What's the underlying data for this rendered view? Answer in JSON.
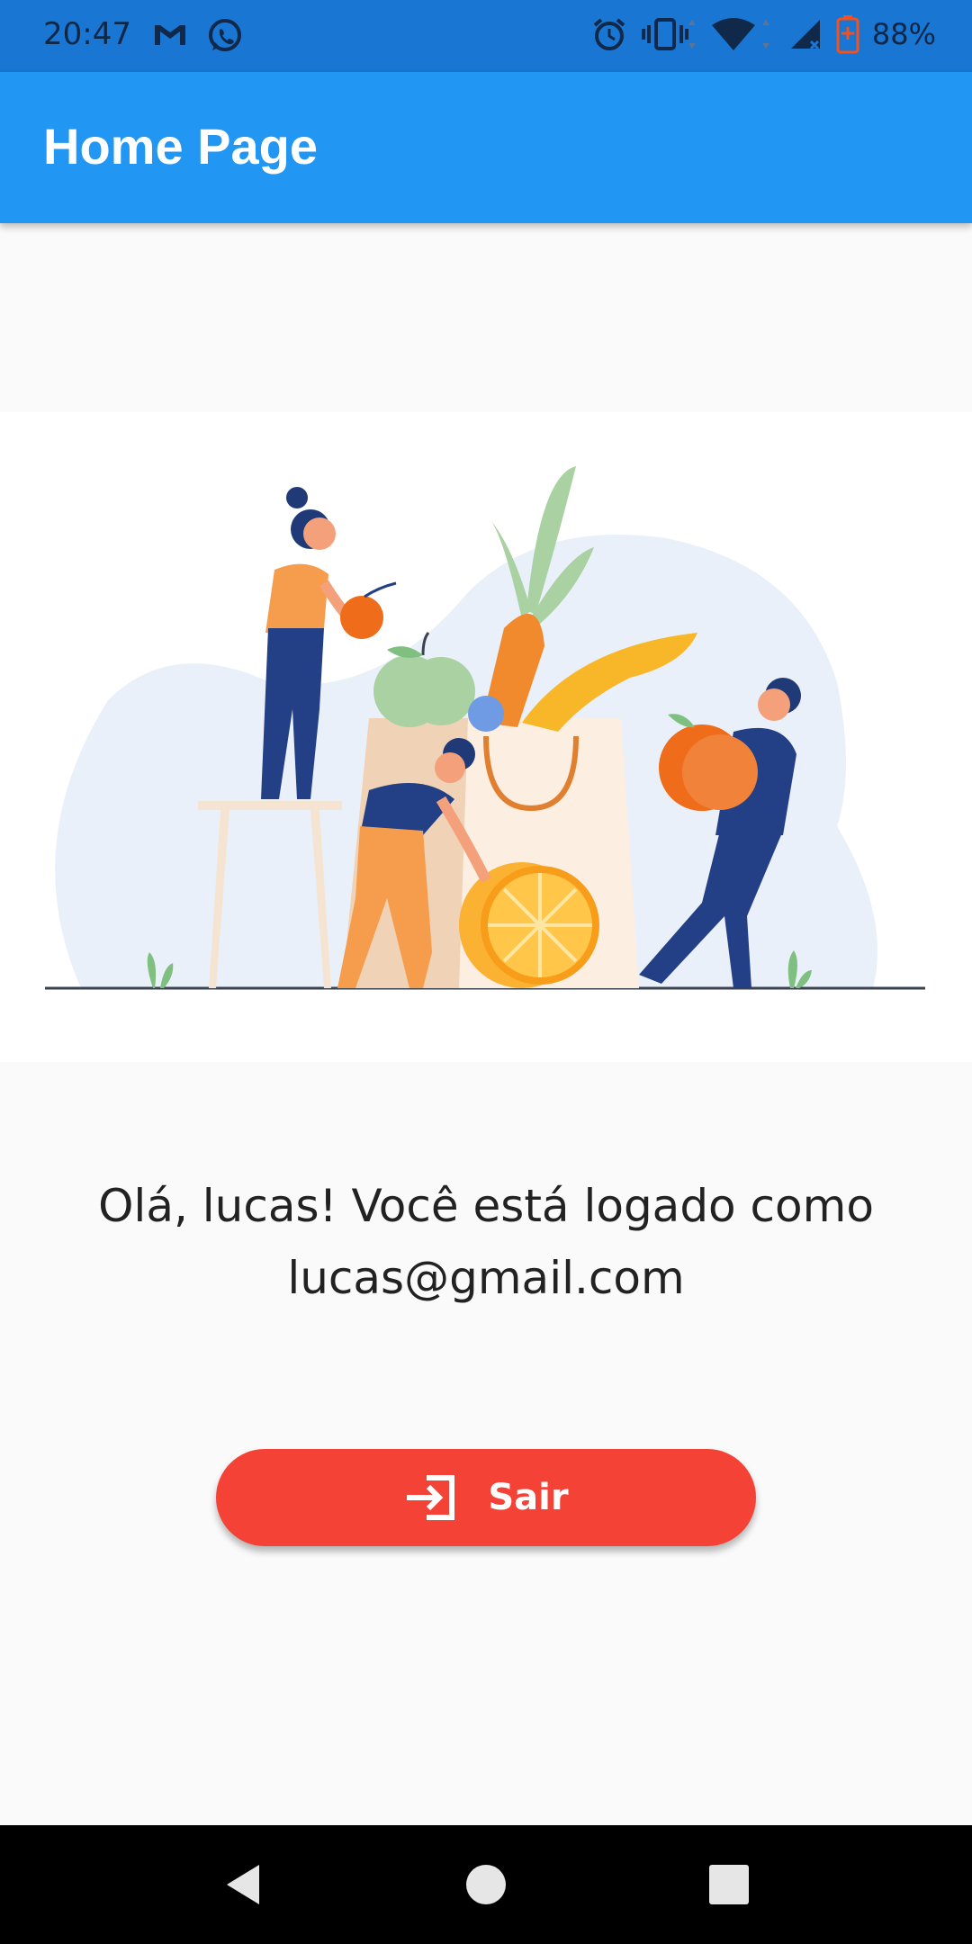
{
  "status_bar": {
    "time": "20:47",
    "battery": "88%",
    "icons": [
      "gmail-icon",
      "whatsapp-icon",
      "alarm-icon",
      "vibrate-icon",
      "wifi-icon",
      "signal-icon",
      "battery-icon"
    ]
  },
  "app_bar": {
    "title": "Home Page",
    "color": "#2196f3"
  },
  "main": {
    "greeting_line1": "Olá, lucas! Você está logado como",
    "greeting_line2": "lucas@gmail.com",
    "logout_button": {
      "label": "Sair",
      "icon": "login-icon",
      "color": "#f44336"
    }
  },
  "nav_bar": {
    "buttons": [
      "back-icon",
      "home-icon",
      "recents-icon"
    ]
  }
}
